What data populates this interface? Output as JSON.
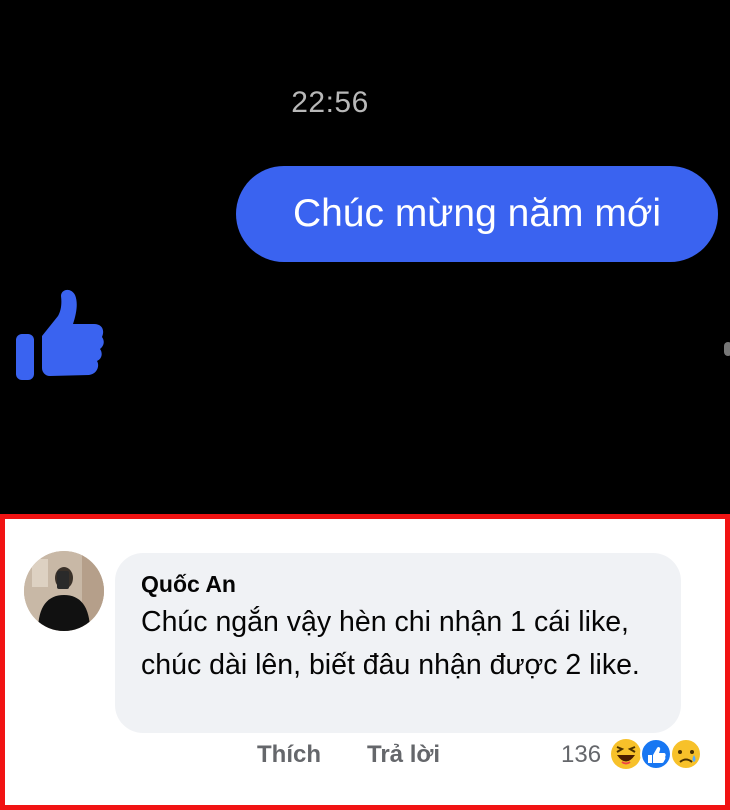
{
  "chat": {
    "time": "22:56",
    "message": "Chúc mừng năm mới",
    "reaction_icon": "thumbs-up-icon",
    "bubble_color": "#3a63f0",
    "background_color": "#000000"
  },
  "comment": {
    "author": "Quốc An",
    "text": "Chúc ngắn vậy hèn chi nhận 1 cái like, chúc dài lên, biết đâu nhận được 2 like.",
    "actions": {
      "like_label": "Thích",
      "reply_label": "Trả lời"
    },
    "reaction_count": "136",
    "reaction_icons": [
      "haha-icon",
      "like-icon",
      "sad-icon"
    ],
    "highlight_border_color": "#f11313"
  }
}
